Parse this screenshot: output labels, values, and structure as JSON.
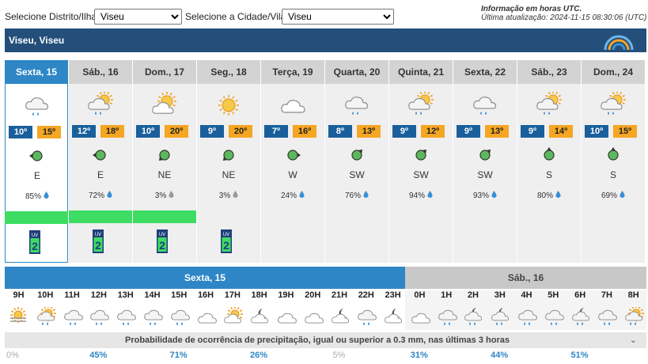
{
  "selectors": {
    "district_label": "Selecione Distrito/Ilha:",
    "district_value": "Viseu",
    "city_label": "Selecione a Cidade/Vila:",
    "city_value": "Viseu"
  },
  "info": {
    "line1": "Informação em horas UTC.",
    "line2": "Última atualização: 2024-11-15 08:30:06 (UTC)"
  },
  "title": "Viseu, Viseu",
  "days": [
    {
      "label": "Sexta, 15",
      "icon": "rain-cloud-icon",
      "tmin": "10º",
      "tmax": "15º",
      "wind": "E",
      "precip": "85%",
      "green": true,
      "uv": "2"
    },
    {
      "label": "Sáb., 16",
      "icon": "sun-rain-cloud-icon",
      "tmin": "12º",
      "tmax": "18º",
      "wind": "E",
      "precip": "72%",
      "green": true,
      "uv": "2"
    },
    {
      "label": "Dom., 17",
      "icon": "sun-cloud-icon",
      "tmin": "10º",
      "tmax": "20º",
      "wind": "NE",
      "precip": "3%",
      "green": true,
      "uv": "2"
    },
    {
      "label": "Seg., 18",
      "icon": "sun-icon",
      "tmin": "9º",
      "tmax": "20º",
      "wind": "NE",
      "precip": "3%",
      "green": false,
      "uv": "2"
    },
    {
      "label": "Terça, 19",
      "icon": "cloud-icon",
      "tmin": "7º",
      "tmax": "16º",
      "wind": "W",
      "precip": "24%",
      "green": false,
      "uv": ""
    },
    {
      "label": "Quarta, 20",
      "icon": "rain-cloud-icon",
      "tmin": "8º",
      "tmax": "13º",
      "wind": "SW",
      "precip": "76%",
      "green": false,
      "uv": ""
    },
    {
      "label": "Quinta, 21",
      "icon": "sun-rain-cloud-icon",
      "tmin": "9º",
      "tmax": "12º",
      "wind": "SW",
      "precip": "94%",
      "green": false,
      "uv": ""
    },
    {
      "label": "Sexta, 22",
      "icon": "rain-cloud-icon",
      "tmin": "9º",
      "tmax": "13º",
      "wind": "SW",
      "precip": "93%",
      "green": false,
      "uv": ""
    },
    {
      "label": "Sáb., 23",
      "icon": "sun-rain-cloud-icon",
      "tmin": "9º",
      "tmax": "14º",
      "wind": "S",
      "precip": "80%",
      "green": false,
      "uv": ""
    },
    {
      "label": "Dom., 24",
      "icon": "sun-rain-cloud-icon",
      "tmin": "10º",
      "tmax": "15º",
      "wind": "S",
      "precip": "69%",
      "green": false,
      "uv": ""
    }
  ],
  "hourly": {
    "day1": "Sexta, 15",
    "day2": "Sáb., 16",
    "hours": [
      "9H",
      "10H",
      "11H",
      "12H",
      "13H",
      "14H",
      "15H",
      "16H",
      "17H",
      "18H",
      "19H",
      "20H",
      "21H",
      "22H",
      "23H",
      "0H",
      "1H",
      "2H",
      "3H",
      "4H",
      "5H",
      "6H",
      "7H",
      "8H"
    ],
    "icons": [
      "fog-sun-icon",
      "sun-rain-icon",
      "rain-icon",
      "rain-icon",
      "rain-icon",
      "rain-icon",
      "rain-icon",
      "cloud-icon",
      "sun-cloud-icon",
      "moon-cloud-icon",
      "cloud-icon",
      "cloud-icon",
      "moon-cloud-icon",
      "rain-icon",
      "moon-cloud-icon",
      "cloud-icon",
      "rain-icon",
      "moon-rain-icon",
      "moon-rain-icon",
      "rain-icon",
      "rain-icon",
      "moon-rain-icon",
      "rain-icon",
      "sun-rain-icon"
    ],
    "prob_title": "Probabilidade de ocorrência de precipitação, igual ou superior a 0.3 mm, nas últimas 3 horas",
    "prob_values": [
      "0%",
      "45%",
      "71%",
      "26%",
      "5%",
      "31%",
      "44%",
      "51%"
    ],
    "prob_low": [
      true,
      false,
      false,
      false,
      true,
      false,
      false,
      false
    ]
  }
}
